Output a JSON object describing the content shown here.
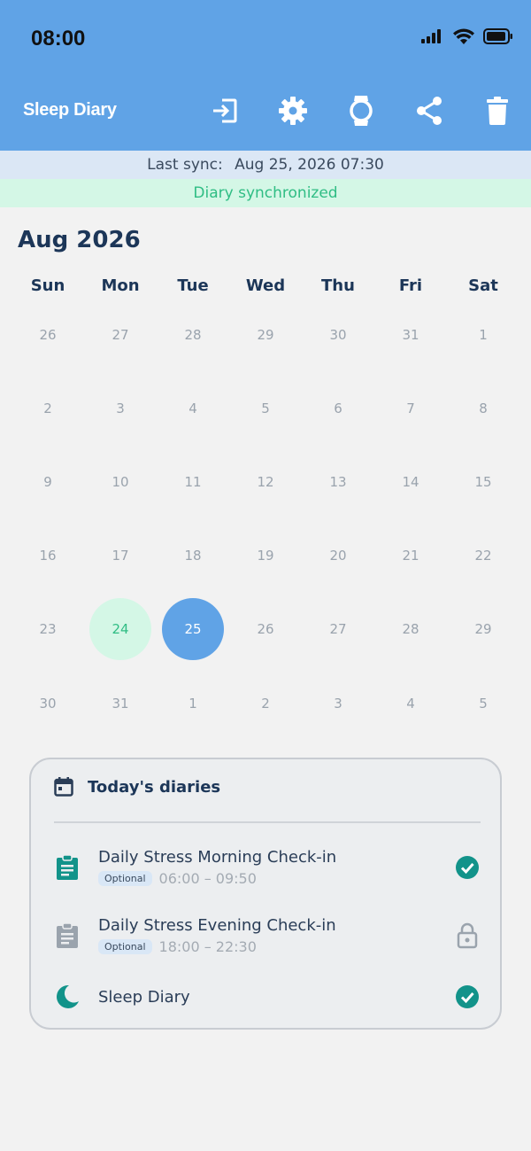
{
  "status_bar": {
    "time": "08:00",
    "icons": [
      "signal-icon",
      "wifi-icon",
      "battery-icon"
    ]
  },
  "header": {
    "title": "Sleep Diary",
    "actions": [
      {
        "name": "login-button",
        "icon": "login-icon"
      },
      {
        "name": "settings-button",
        "icon": "gear-icon"
      },
      {
        "name": "watch-button",
        "icon": "watch-icon"
      },
      {
        "name": "share-button",
        "icon": "share-icon"
      },
      {
        "name": "delete-button",
        "icon": "trash-icon"
      }
    ]
  },
  "sync": {
    "label": "Last sync:",
    "value": "Aug 25, 2026 07:30",
    "status": "Diary synchronized"
  },
  "calendar": {
    "month": "Aug 2026",
    "weekdays": [
      "Sun",
      "Mon",
      "Tue",
      "Wed",
      "Thu",
      "Fri",
      "Sat"
    ],
    "days": [
      "26",
      "27",
      "28",
      "29",
      "30",
      "31",
      "1",
      "2",
      "3",
      "4",
      "5",
      "6",
      "7",
      "8",
      "9",
      "10",
      "11",
      "12",
      "13",
      "14",
      "15",
      "16",
      "17",
      "18",
      "19",
      "20",
      "21",
      "22",
      "23",
      "24",
      "25",
      "26",
      "27",
      "28",
      "29",
      "30",
      "31",
      "1",
      "2",
      "3",
      "4",
      "5"
    ],
    "completed_day": "24",
    "selected_day": "25"
  },
  "diaries": {
    "title": "Today's diaries",
    "items": [
      {
        "name": "Daily Stress Morning Check-in",
        "badge": "Optional",
        "time": "06:00 – 09:50",
        "status": "completed",
        "icon": "clipboard-icon"
      },
      {
        "name": "Daily Stress Evening Check-in",
        "badge": "Optional",
        "time": "18:00 – 22:30",
        "status": "locked",
        "icon": "clipboard-icon"
      },
      {
        "name": "Sleep Diary",
        "status": "completed",
        "icon": "moon-icon"
      }
    ]
  },
  "colors": {
    "primary": "#60a3e6",
    "success": "#2fbd84",
    "teal": "#12938a",
    "text": "#1c3658"
  }
}
